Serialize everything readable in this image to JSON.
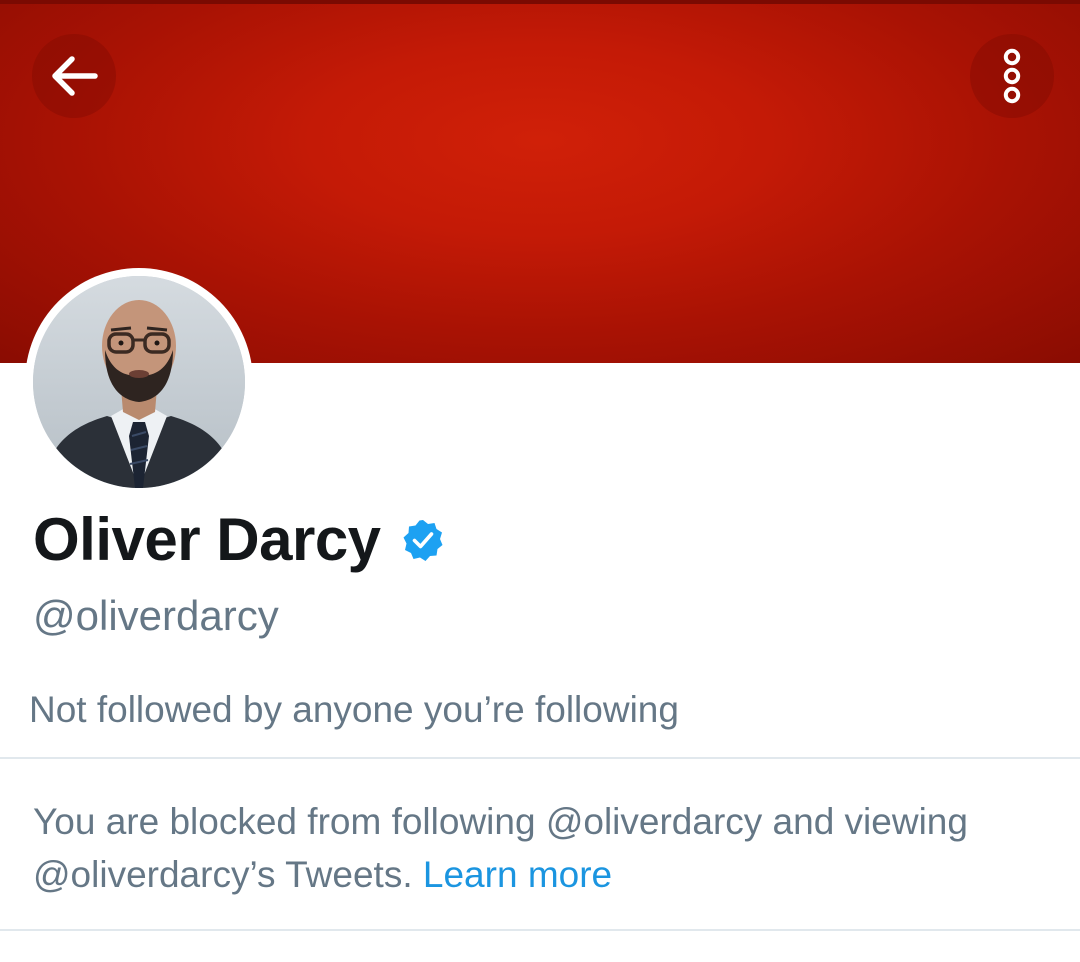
{
  "header": {
    "back_icon": "arrow-left-icon",
    "more_icon": "more-vertical-icon",
    "banner_color": "#c41a06"
  },
  "profile": {
    "display_name": "Oliver Darcy",
    "verified_icon": "verified-badge-icon",
    "verified_color": "#1da1f2",
    "handle": "@oliverdarcy",
    "followed_by_text": "Not followed by anyone you’re following"
  },
  "block_notice": {
    "message": "You are blocked from following @oliverdarcy and viewing @oliverdarcy’s Tweets.",
    "link_label": "Learn more",
    "link_color": "#1b95e0"
  }
}
